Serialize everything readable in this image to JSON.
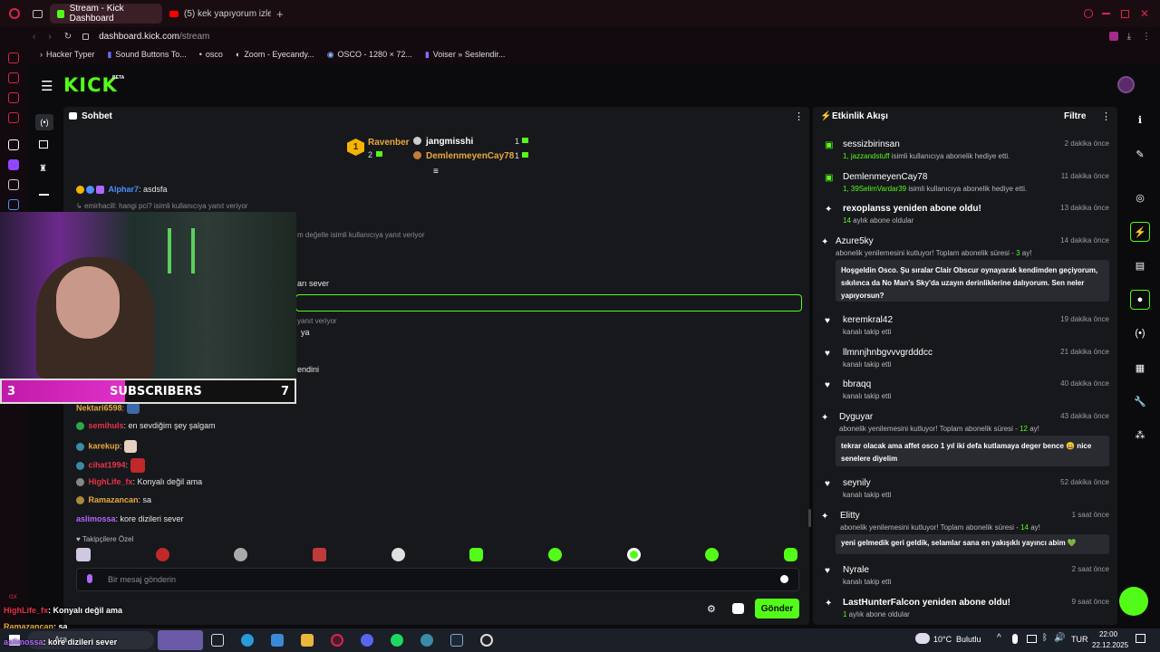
{
  "browser": {
    "tabs": [
      {
        "label": "Stream - Kick Dashboard",
        "active": true
      },
      {
        "label": "(5) kek yapıyorum izle - Y",
        "active": false
      }
    ],
    "address": {
      "domain": "dashboard.kick.com",
      "path": "/stream"
    },
    "bookmarks": [
      "Hacker Typer",
      "Sound Buttons To...",
      "osco",
      "Zoom - Eyecandy...",
      "OSCO - 1280 × 72...",
      "Voiser » Seslendir..."
    ]
  },
  "kick": {
    "logo": "KICK",
    "beta": "BETA"
  },
  "chat": {
    "title": "Sohbet",
    "leaderboard": {
      "first": {
        "rank": "1",
        "name": "Ravenber",
        "count": "2"
      },
      "second": {
        "name": "jangmisshi",
        "count": "1"
      },
      "third": {
        "name": "DemlenmeyenCay78",
        "count": "1"
      }
    },
    "messages": [
      {
        "user": "Alphar7",
        "text": ": asdsfa",
        "color": "#4a90ff"
      },
      {
        "user": "",
        "text": "emirhacill: hangi pci? isimli kullanıcıya yanıt veriyor",
        "color": "#8a8a8f"
      },
      {
        "user": "",
        "text": "m değelle isimli kullanıcıya yanıt veriyor",
        "color": "#8a8a8f"
      },
      {
        "user": "",
        "text": "arı sever",
        "color": "#e6e6e6"
      },
      {
        "user": "",
        "text": "yanıt veriyor",
        "color": "#8a8a8f"
      },
      {
        "user": "",
        "text": "ya",
        "color": "#e6e6e6"
      },
      {
        "user": "",
        "text": "endini",
        "color": "#e6e6e6"
      },
      {
        "user": "Nektari6598",
        "text": ":",
        "color": "#e8a93a"
      },
      {
        "user": "semihuls",
        "text": ": en sevdiğim şey şalgam",
        "color": "#e8324a"
      },
      {
        "user": "karekup",
        "text": ":",
        "color": "#e8a93a"
      },
      {
        "user": "cihat1994",
        "text": ":",
        "color": "#e8324a"
      },
      {
        "user": "HighLife_fx",
        "text": ": Konyalı değil ama",
        "color": "#e8324a"
      },
      {
        "user": "Ramazancan",
        "text": ": sa",
        "color": "#e8a93a"
      },
      {
        "user": "aslimossa",
        "text": ": kore dizileri sever",
        "color": "#b066ff"
      }
    ],
    "followers_only": "Takipçilere Özel",
    "input_placeholder": "Bir mesaj gönderin",
    "send_label": "Gönder"
  },
  "feed": {
    "title": "Etkinlik Akışı",
    "filter_label": "Filtre",
    "events": [
      {
        "name": "sessizbirinsan",
        "time": "2 dakika önce",
        "sub_pre": "1, ",
        "sub_hl": "jazzandstuff",
        "sub_post": " isimli kullanıcıya abonelik hediye etti.",
        "icon": "gift"
      },
      {
        "name": "DemlenmeyenCay78",
        "time": "11 dakika önce",
        "sub_pre": "1, ",
        "sub_hl": "39SelimVardar39",
        "sub_post": " isimli kullanıcıya abonelik hediye etti.",
        "icon": "gift"
      },
      {
        "name": "rexoplanss yeniden abone oldu!",
        "time": "13 dakika önce",
        "sub_pre": "",
        "sub_hl": "14",
        "sub_post": " aylık abone oldular",
        "icon": "star"
      },
      {
        "name": "Azure5ky",
        "time": "14 dakika önce",
        "sub_pre": "abonelik yenilemesini kutluyor! Toplam abonelik süresi - ",
        "sub_hl": "3",
        "sub_post": " ay!",
        "quote": "Hoşgeldin Osco. Şu sıralar Clair Obscur oynayarak kendimden geçiyorum, sıkılınca da No Man's Sky'da uzayın derinliklerine dalıyorum. Sen neler yapıyorsun?",
        "icon": "star"
      },
      {
        "name": "keremkral42",
        "time": "19 dakika önce",
        "sub_pre": "kanalı takip etti",
        "sub_hl": "",
        "sub_post": "",
        "icon": "heart"
      },
      {
        "name": "llmnnjhnbgvvvgrdddcc",
        "time": "21 dakika önce",
        "sub_pre": "kanalı takip etti",
        "sub_hl": "",
        "sub_post": "",
        "icon": "heart"
      },
      {
        "name": "bbraqq",
        "time": "40 dakika önce",
        "sub_pre": "kanalı takip etti",
        "sub_hl": "",
        "sub_post": "",
        "icon": "heart"
      },
      {
        "name": "Dyguyar",
        "time": "43 dakika önce",
        "sub_pre": "abonelik yenilemesini kutluyor! Toplam abonelik süresi - ",
        "sub_hl": "12",
        "sub_post": " ay!",
        "quote": "tekrar olacak ama affet osco 1 yıl iki defa kutlamaya deger bence 😄 nice senelere diyelim",
        "icon": "star"
      },
      {
        "name": "seynily",
        "time": "52 dakika önce",
        "sub_pre": "kanalı takip etti",
        "sub_hl": "",
        "sub_post": "",
        "icon": "heart"
      },
      {
        "name": "Elitty",
        "time": "1 saat önce",
        "sub_pre": "abonelik yenilemesini kutluyor! Toplam abonelik süresi - ",
        "sub_hl": "14",
        "sub_post": " ay!",
        "quote": "yeni gelmedik geri geldik, selamlar sana en yakışıklı yayıncı abim 💚",
        "icon": "star"
      },
      {
        "name": "Nyrale",
        "time": "2 saat önce",
        "sub_pre": "kanalı takip etti",
        "sub_hl": "",
        "sub_post": "",
        "icon": "heart"
      },
      {
        "name": "LastHunterFalcon yeniden abone oldu!",
        "time": "9 saat önce",
        "sub_pre": "",
        "sub_hl": "1",
        "sub_post": " aylık abone oldular",
        "icon": "star"
      }
    ]
  },
  "overlay": {
    "subscribers_label": "SUBSCRIBERS",
    "left_count": "3",
    "right_count": "7",
    "chat": [
      {
        "user": "HighLife_fx",
        "text": ": Konyalı değil ama",
        "color": "#e8324a"
      },
      {
        "user": "Ramazancan",
        "text": ": sa",
        "color": "#e8a93a"
      },
      {
        "user": "aslimossa",
        "text": ": kore dizileri sever",
        "color": "#b066ff"
      }
    ]
  },
  "taskbar": {
    "search_placeholder": "Ara",
    "weather_temp": "10°C",
    "weather_desc": "Bulutlu",
    "lang": "TUR",
    "time": "22:00",
    "date": "22.12.2025"
  },
  "colors": {
    "accent": "#53fc18",
    "opera_red": "#d8254d",
    "panel": "#17181c"
  }
}
